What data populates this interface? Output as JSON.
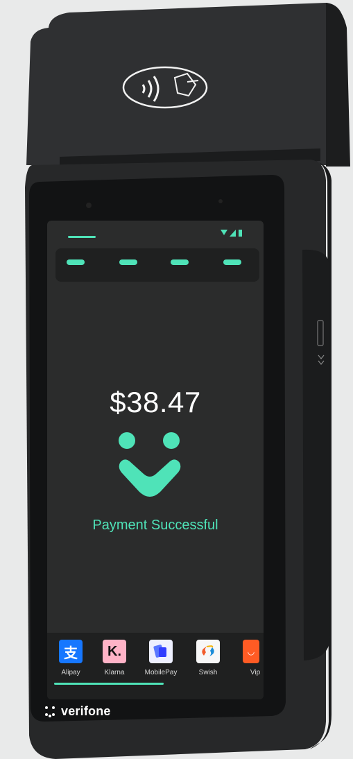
{
  "device": {
    "brand_name": "verifone"
  },
  "screen": {
    "amount": "$38.47",
    "status": "Payment Successful",
    "apps": [
      {
        "label": "Alipay",
        "icon": "alipay-icon",
        "color": "#1677ff"
      },
      {
        "label": "Klarna",
        "icon": "klarna-icon",
        "color": "#ffb3c7"
      },
      {
        "label": "MobilePay",
        "icon": "mobilepay-icon",
        "color": "#5a78ff"
      },
      {
        "label": "Swish",
        "icon": "swish-icon",
        "color": "#f7f7f7"
      },
      {
        "label": "Vip",
        "icon": "vipps-icon",
        "color": "#ff5b24"
      }
    ]
  },
  "colors": {
    "accent": "#4fe3b8",
    "screen_bg": "#2b2c2c",
    "body": "#2a2b2c"
  }
}
